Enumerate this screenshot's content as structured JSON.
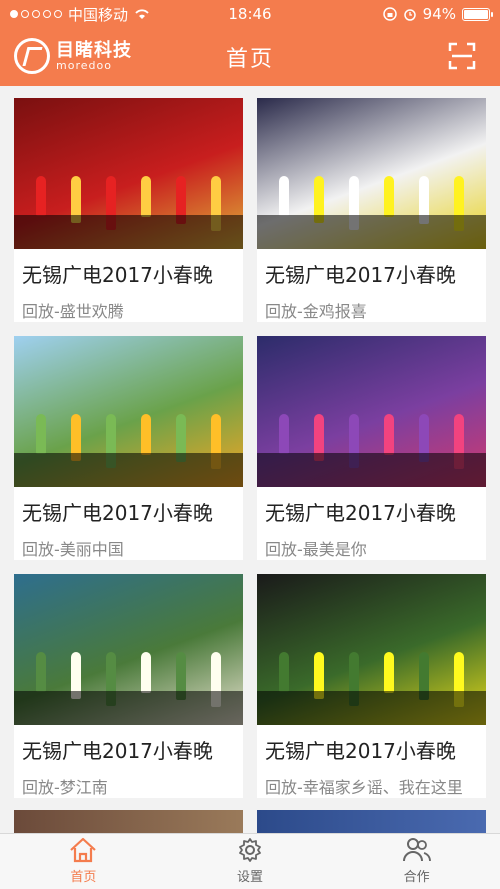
{
  "status_bar": {
    "carrier": "中国移动",
    "time": "18:46",
    "battery": "94%",
    "battery_level": 0.94
  },
  "header": {
    "logo_name": "目睹科技",
    "logo_sub": "moredoo",
    "title": "首页"
  },
  "videos": [
    {
      "title": "无锡广电2017小春晚",
      "subtitle": "回放-盛世欢腾",
      "colors": [
        "#c81e1e",
        "#e0b23a",
        "#7a1010"
      ]
    },
    {
      "title": "无锡广电2017小春晚",
      "subtitle": "回放-金鸡报喜",
      "colors": [
        "#f2f2f2",
        "#e8d21c",
        "#2a2a4a"
      ]
    },
    {
      "title": "无锡广电2017小春晚",
      "subtitle": "回放-美丽中国",
      "colors": [
        "#6aa24a",
        "#f5a623",
        "#9fd0f0"
      ]
    },
    {
      "title": "无锡广电2017小春晚",
      "subtitle": "回放-最美是你",
      "colors": [
        "#7b3fa0",
        "#d23a6e",
        "#2c2c6a"
      ]
    },
    {
      "title": "无锡广电2017小春晚",
      "subtitle": "回放-梦江南",
      "colors": [
        "#4a7a3a",
        "#e8e2d0",
        "#2e6e8e"
      ]
    },
    {
      "title": "无锡广电2017小春晚",
      "subtitle": "回放-幸福家乡谣、我在这里",
      "colors": [
        "#3a6a2a",
        "#e6d91a",
        "#1a1a1a"
      ]
    }
  ],
  "tabs": [
    {
      "label": "首页"
    },
    {
      "label": "设置"
    },
    {
      "label": "合作"
    }
  ],
  "accent_color": "#f47c4d"
}
